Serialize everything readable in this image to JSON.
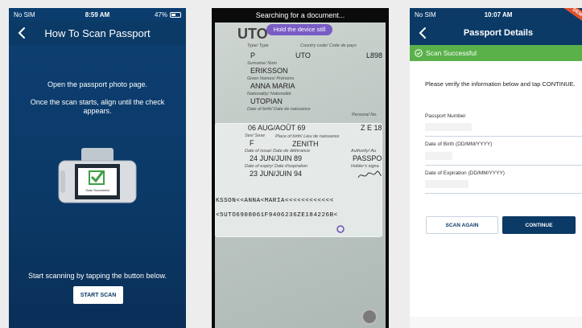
{
  "phone1": {
    "status": {
      "carrier": "No SIM",
      "time": "8:59 AM",
      "battery": "47%"
    },
    "title": "How To Scan Passport",
    "instruction_1": "Open the passport photo page.",
    "instruction_2": "Once the scan starts, align until the check appears.",
    "illustration_label": "Scan Successful",
    "instruction_3": "Start scanning by tapping the button below.",
    "start_button": "START SCAN"
  },
  "phone2": {
    "top_status": "Searching for a document...",
    "hint": "Hold the device still",
    "passport": {
      "type_label": "Type/ Type",
      "type_value": "P",
      "country_label": "Country code/ Code de pays",
      "country_value": "UTO",
      "passport_no_partial": "L898",
      "header_partial": "UTO",
      "surname_label": "Surname/ Nom",
      "surname": "ERIKSSON",
      "given_label": "Given Names/ Prénoms",
      "given_names": "ANNA MARIA",
      "nationality_label": "Nationality/ Nationalité",
      "nationality": "UTOPIAN",
      "dob_label": "Date of birth/ Date de naissance",
      "dob": "06 AUG/AOÛT 69",
      "personal_label": "Personal No.",
      "personal_partial": "Z E 18",
      "sex_label": "Sex/ Sexe",
      "sex": "F",
      "pob_label": "Place of birth/ Lieu de naissance",
      "pob": "ZENITH",
      "issue_label": "Date of issue/ Date de délivrance",
      "issue": "24 JUN/JUIN 89",
      "authority_label": "Authority/ Au",
      "authority_partial": "PASSPO",
      "expiry_label": "Date of expiry/ Date d'expiration",
      "expiry": "23 JUN/JUIN 94",
      "holder_label": "Holder's signa",
      "mrz_line1": "KSSON<<ANNA<MARIA<<<<<<<<<<<<",
      "mrz_line2": "<5UTO6908061F9406236ZE184226B<"
    }
  },
  "phone3": {
    "status": {
      "carrier": "No SIM",
      "time": "10:07 AM"
    },
    "ribbon": "DEMO",
    "title": "Passport Details",
    "success": "Scan Successful",
    "instruction": "Please verify the information below and tap CONTINUE.",
    "fields": [
      {
        "label": "Passport Number",
        "value": ""
      },
      {
        "label": "Date of Birth (DD/MM/YYYY)",
        "value": ""
      },
      {
        "label": "Date of Expiration (DD/MM/YYYY)",
        "value": ""
      }
    ],
    "scan_again": "SCAN AGAIN",
    "continue": "CONTINUE"
  },
  "colors": {
    "brand_navy": "#0b3a66",
    "success_green": "#5ab14a",
    "hint_purple": "#7a5cc5",
    "demo_orange": "#e0522d"
  }
}
